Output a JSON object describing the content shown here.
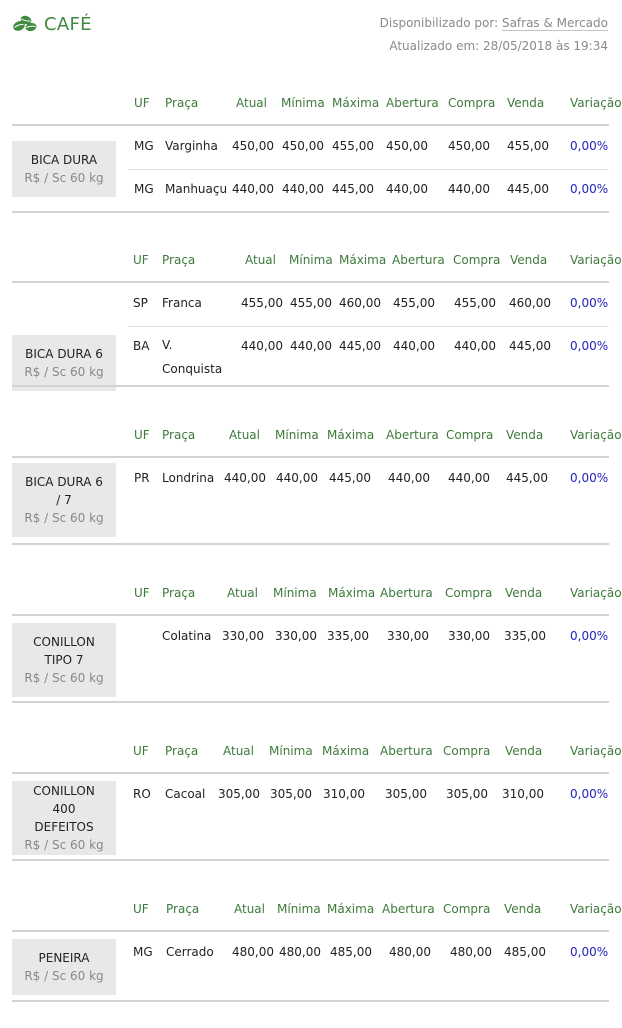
{
  "header": {
    "title": "CAFÉ",
    "source_prefix": "Disponibilizado por:",
    "source_link": "Safras & Mercado",
    "updated": "Atualizado em: 28/05/2018 às 19:34"
  },
  "colors": {
    "accent": "#3e8a3e",
    "variation": "#2222bb",
    "label_bg": "#e8e8e8"
  },
  "columns": [
    "UF",
    "Praça",
    "Atual",
    "Mínima",
    "Máxima",
    "Abertura",
    "Compra",
    "Venda",
    "Variação"
  ],
  "groups": [
    {
      "name": "BICA DURA",
      "unit": "R$ / Sc 60 kg",
      "rows": [
        {
          "uf": "MG",
          "praca": "Varginha",
          "atual": "450,00",
          "minima": "450,00",
          "maxima": "455,00",
          "abertura": "450,00",
          "compra": "450,00",
          "venda": "455,00",
          "variacao": "0,00%"
        },
        {
          "uf": "MG",
          "praca": "Manhuaçu",
          "atual": "440,00",
          "minima": "440,00",
          "maxima": "445,00",
          "abertura": "440,00",
          "compra": "440,00",
          "venda": "445,00",
          "variacao": "0,00%"
        }
      ]
    },
    {
      "name": "BICA DURA 6",
      "unit": "R$ / Sc 60 kg",
      "rows": [
        {
          "uf": "SP",
          "praca": "Franca",
          "atual": "455,00",
          "minima": "455,00",
          "maxima": "460,00",
          "abertura": "455,00",
          "compra": "455,00",
          "venda": "460,00",
          "variacao": "0,00%"
        },
        {
          "uf": "BA",
          "praca": "V. Conquista",
          "atual": "440,00",
          "minima": "440,00",
          "maxima": "445,00",
          "abertura": "440,00",
          "compra": "440,00",
          "venda": "445,00",
          "variacao": "0,00%"
        }
      ]
    },
    {
      "name": "BICA DURA 6 / 7",
      "unit": "R$ / Sc 60 kg",
      "rows": [
        {
          "uf": "PR",
          "praca": "Londrina",
          "atual": "440,00",
          "minima": "440,00",
          "maxima": "445,00",
          "abertura": "440,00",
          "compra": "440,00",
          "venda": "445,00",
          "variacao": "0,00%"
        }
      ]
    },
    {
      "name": "CONILLON TIPO 7",
      "unit": "R$ / Sc 60 kg",
      "rows": [
        {
          "uf": "",
          "praca": "Colatina",
          "atual": "330,00",
          "minima": "330,00",
          "maxima": "335,00",
          "abertura": "330,00",
          "compra": "330,00",
          "venda": "335,00",
          "variacao": "0,00%"
        }
      ]
    },
    {
      "name": "CONILLON 400 DEFEITOS",
      "unit": "R$ / Sc 60 kg",
      "rows": [
        {
          "uf": "RO",
          "praca": "Cacoal",
          "atual": "305,00",
          "minima": "305,00",
          "maxima": "310,00",
          "abertura": "305,00",
          "compra": "305,00",
          "venda": "310,00",
          "variacao": "0,00%"
        }
      ]
    },
    {
      "name": "PENEIRA",
      "unit": "R$ / Sc 60 kg",
      "rows": [
        {
          "uf": "MG",
          "praca": "Cerrado",
          "atual": "480,00",
          "minima": "480,00",
          "maxima": "485,00",
          "abertura": "480,00",
          "compra": "480,00",
          "venda": "485,00",
          "variacao": "0,00%"
        }
      ]
    }
  ]
}
